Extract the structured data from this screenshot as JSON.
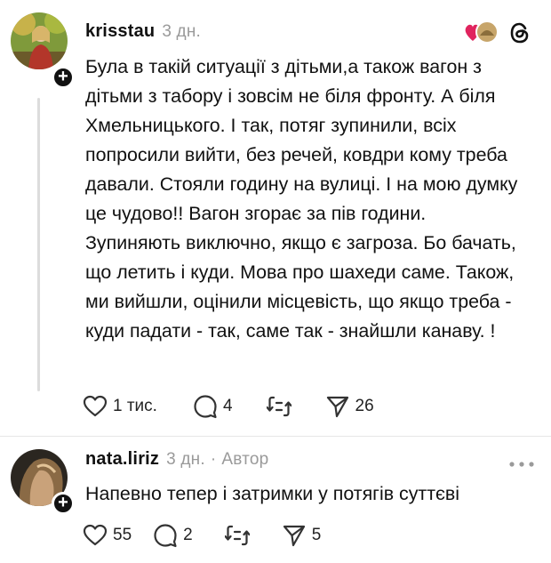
{
  "post1": {
    "username": "krisstau",
    "time": "3 дн.",
    "text": "Була в такій ситуації з дітьми,а також вагон з дітьми з табору  і зовсім не біля фронту. А біля Хмельницького. І так, потяг зупинили, всіх попросили вийти, без речей, ковдри кому треба давали.  Стояли годину на вулиці. І на мою думку це чудово!! Вагон згорає за пів години. Зупиняють виключно, якщо є загроза. Бо бачать, що летить і куди. Мова про шахеди саме. Також, ми вийшли, оцінили місцевість, що якщо треба - куди падати - так, саме так - знайшли канаву. !",
    "likes": "1 тис.",
    "comments": "4",
    "shares": "26"
  },
  "post2": {
    "username": "nata.liriz",
    "time": "3 дн.",
    "separator": "·",
    "author_tag": "Автор",
    "text": "Напевно тепер і затримки у потягів суттєві",
    "likes": "55",
    "comments": "2",
    "shares": "5"
  },
  "icons": {
    "like": "heart-icon",
    "comment": "comment-icon",
    "repost": "repost-icon",
    "share": "send-icon",
    "more": "more-dots-icon",
    "threads": "threads-logo-icon"
  },
  "colors": {
    "heart_red": "#e0245e",
    "muted": "#9a9a9a"
  }
}
